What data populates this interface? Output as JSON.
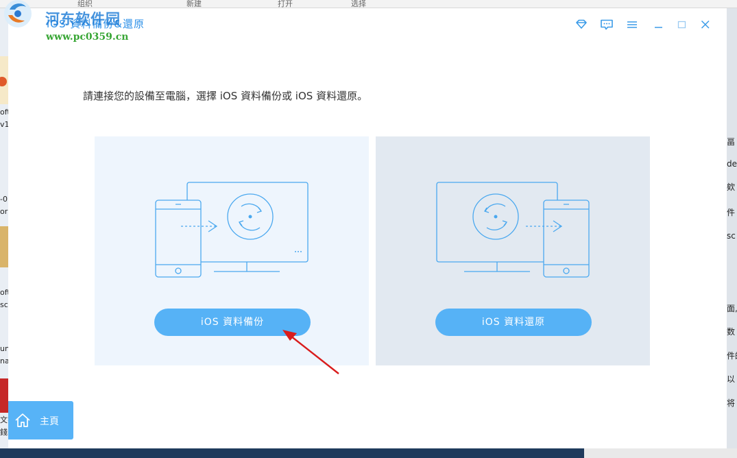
{
  "background": {
    "ribbon_labels": [
      "组织",
      "新建",
      "打开",
      "选择"
    ],
    "left_fragments": [
      "oft",
      "v1",
      "-0",
      "or",
      "oft",
      "sc",
      "un",
      "na",
      "文字",
      "錢"
    ],
    "right_fragments": [
      "畐",
      "de",
      "欸",
      "件",
      "sc",
      "面,",
      "数",
      "件的",
      "以",
      "将"
    ]
  },
  "watermark": {
    "site_name": "河东软件园",
    "url": "www.pc0359.cn"
  },
  "window": {
    "title": "iOS 資料備份&還原"
  },
  "titlebar_icons": [
    "diamond-icon",
    "feedback-icon",
    "menu-icon",
    "minimize-icon",
    "maximize-icon",
    "close-icon"
  ],
  "main": {
    "prompt": "請連接您的設備至電腦，選擇 iOS 資料備份或 iOS 資料還原。",
    "backup_button": "iOS 資料備份",
    "restore_button": "iOS 資料還原"
  },
  "sidebar": {
    "home_label": "主頁"
  },
  "colors": {
    "accent": "#56b2f6",
    "line": "#4aa8ef",
    "annotation_arrow": "#d91c1c"
  }
}
